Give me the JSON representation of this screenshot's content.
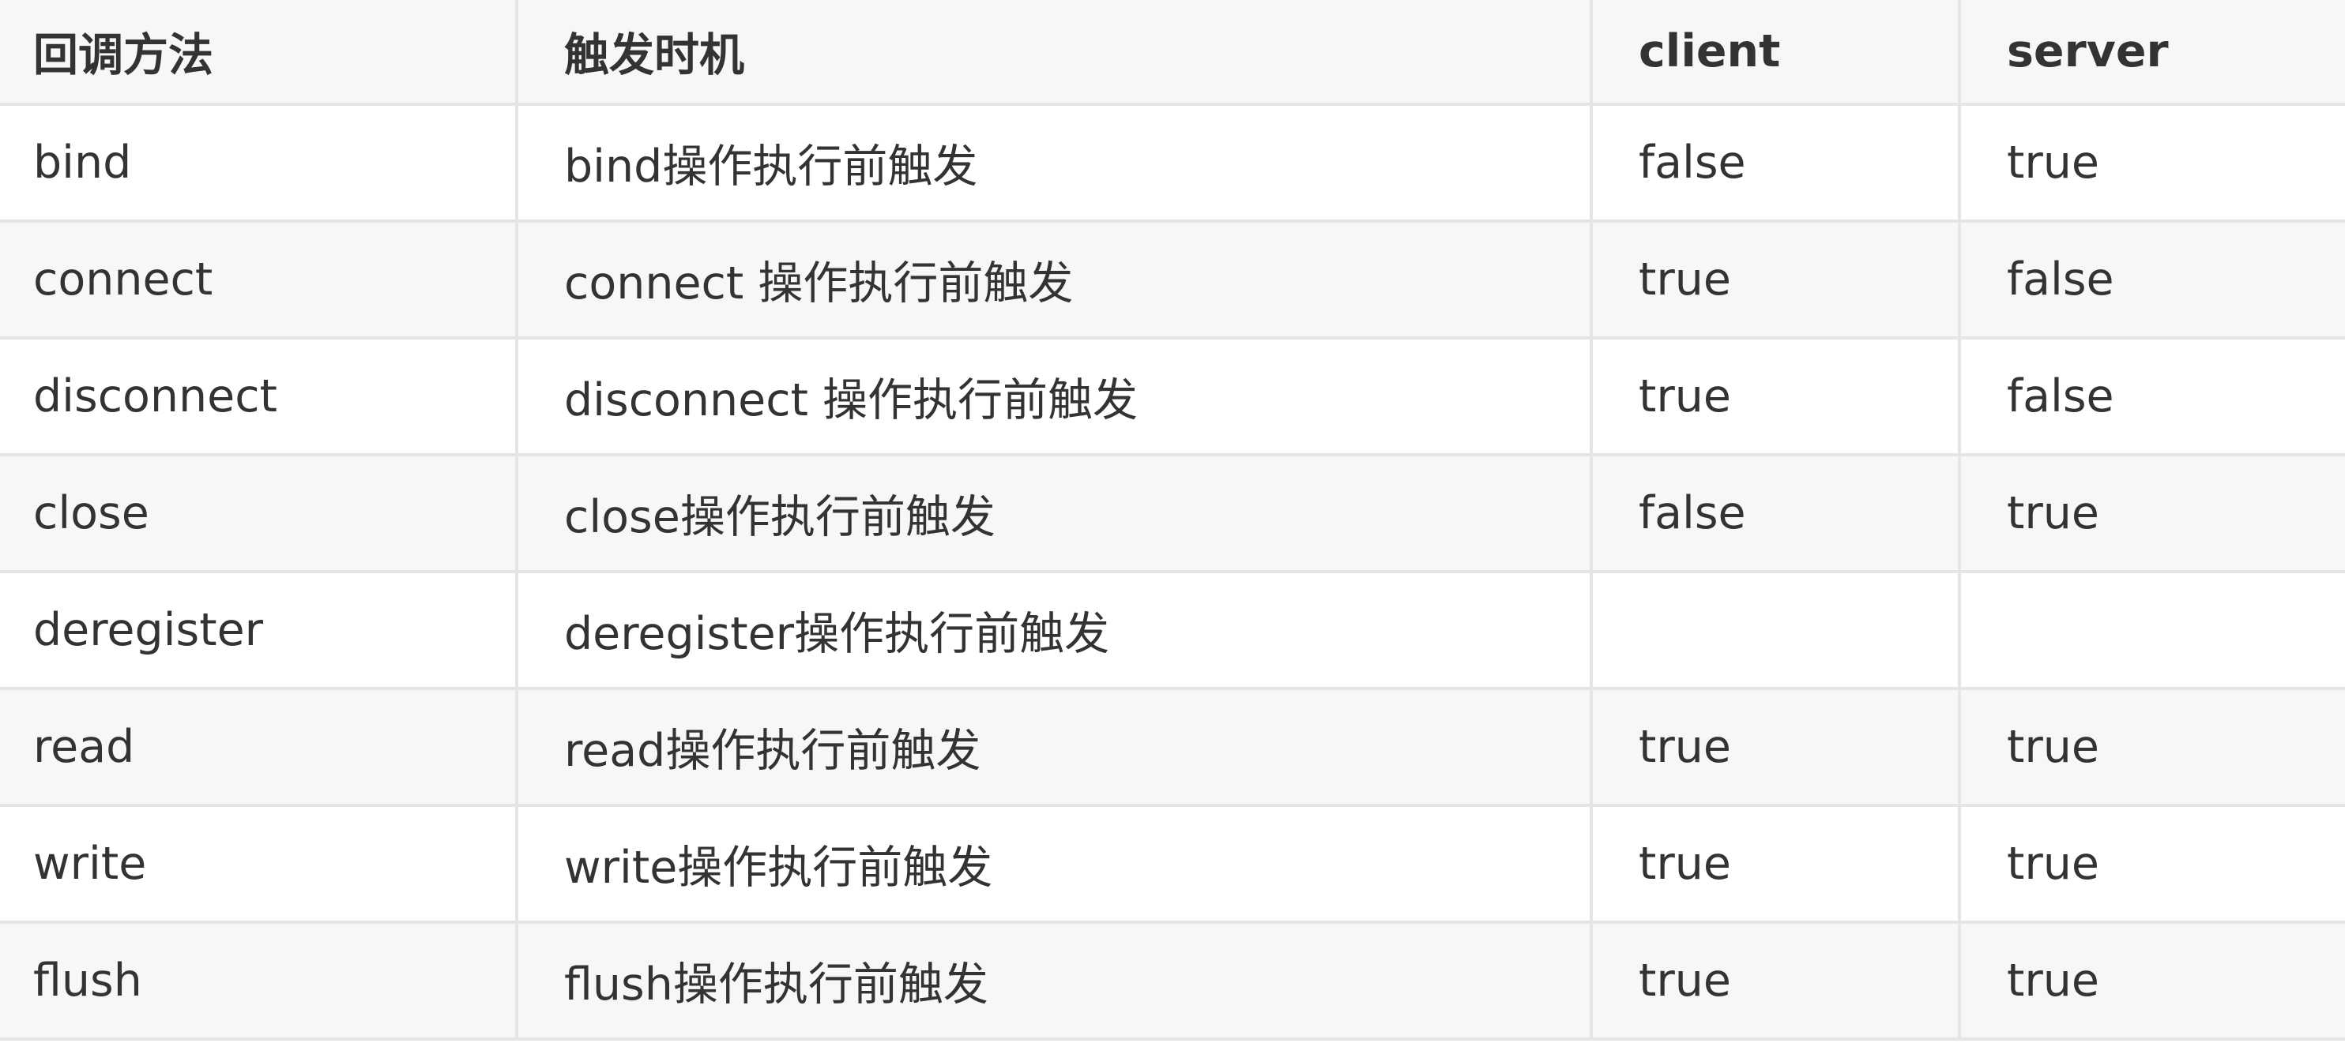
{
  "table": {
    "headers": [
      "回调方法",
      "触发时机",
      "client",
      "server"
    ],
    "rows": [
      [
        "bind",
        "bind操作执行前触发",
        "false",
        "true"
      ],
      [
        "connect",
        "connect 操作执行前触发",
        "true",
        "false"
      ],
      [
        "disconnect",
        "disconnect 操作执行前触发",
        "true",
        "false"
      ],
      [
        "close",
        "close操作执行前触发",
        "false",
        "true"
      ],
      [
        "deregister",
        "deregister操作执行前触发",
        "",
        ""
      ],
      [
        "read",
        "read操作执行前触发",
        "true",
        "true"
      ],
      [
        "write",
        "write操作执行前触发",
        "true",
        "true"
      ],
      [
        "flush",
        "flush操作执行前触发",
        "true",
        "true"
      ]
    ]
  }
}
